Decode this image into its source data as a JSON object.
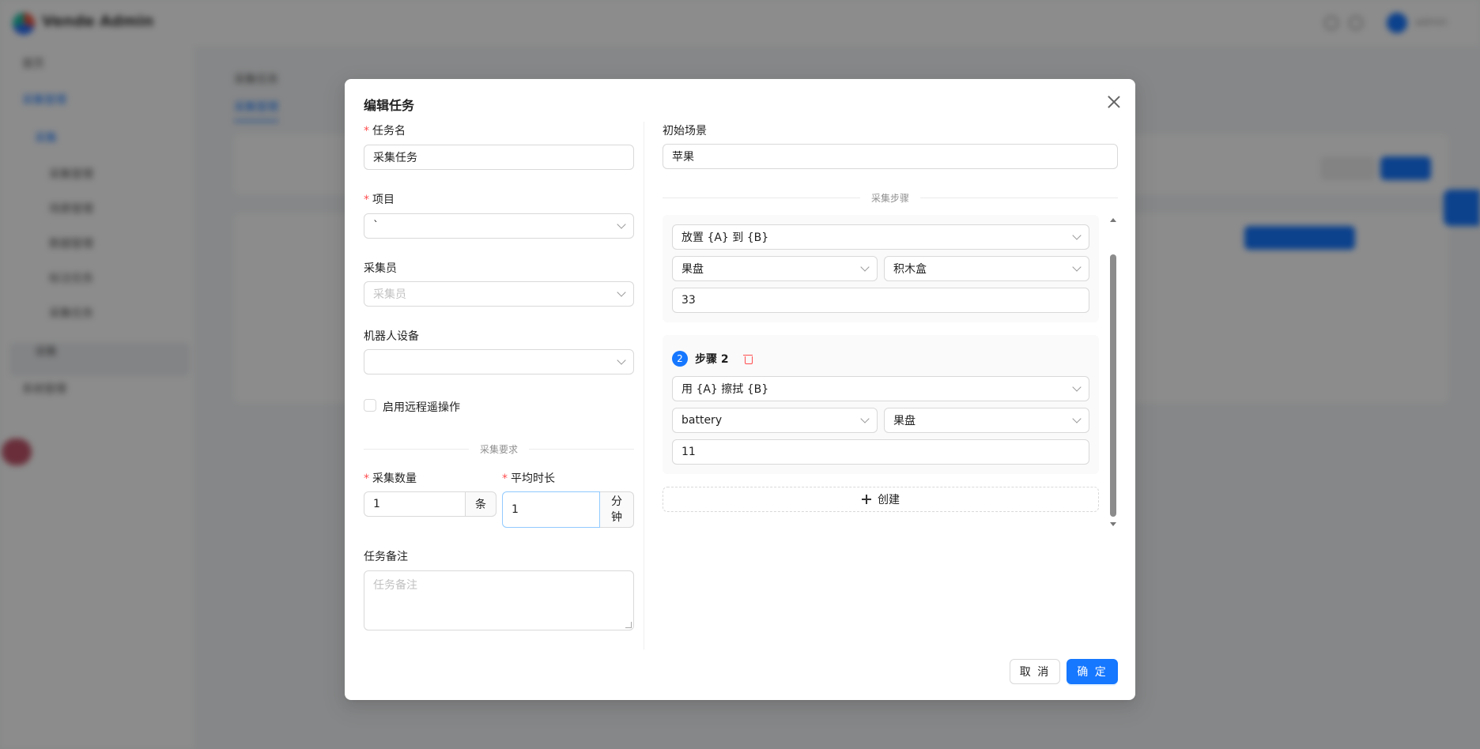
{
  "background": {
    "brand": "Vende Admin",
    "user": "admin",
    "sidebar": [
      "首页",
      "采集管理",
      "采集",
      "采集管理",
      "场景管理",
      "数据管理",
      "标注任务",
      "采集任务",
      "设备",
      "系统管理"
    ],
    "page_title": "采集任务",
    "tab": "采集管理"
  },
  "modal": {
    "title": "编辑任务",
    "left": {
      "task_name": {
        "label": "任务名",
        "value": "采集任务"
      },
      "project": {
        "label": "项目",
        "value": "`"
      },
      "collector": {
        "label": "采集员",
        "placeholder": "采集员"
      },
      "robot": {
        "label": "机器人设备",
        "value": ""
      },
      "remote": {
        "label": "启用远程遥操作"
      },
      "requirements_divider": "采集要求",
      "count": {
        "label": "采集数量",
        "value": "1",
        "unit": "条"
      },
      "duration": {
        "label": "平均时长",
        "value": "1",
        "unit_line1": "分",
        "unit_line2": "钟"
      },
      "note": {
        "label": "任务备注",
        "placeholder": "任务备注"
      }
    },
    "right": {
      "initial_scene": {
        "label": "初始场景",
        "value": "苹果"
      },
      "steps_divider": "采集步骤",
      "steps": [
        {
          "action": "放置 {A} 到 {B}",
          "a": "果盘",
          "b": "积木盒",
          "value": "33"
        },
        {
          "number": "2",
          "title": "步骤 2",
          "action": "用 {A} 擦拭 {B}",
          "a": "battery",
          "b": "果盘",
          "value": "11"
        }
      ],
      "add_label": "创建"
    },
    "cancel_label": "取 消",
    "ok_label": "确 定"
  }
}
